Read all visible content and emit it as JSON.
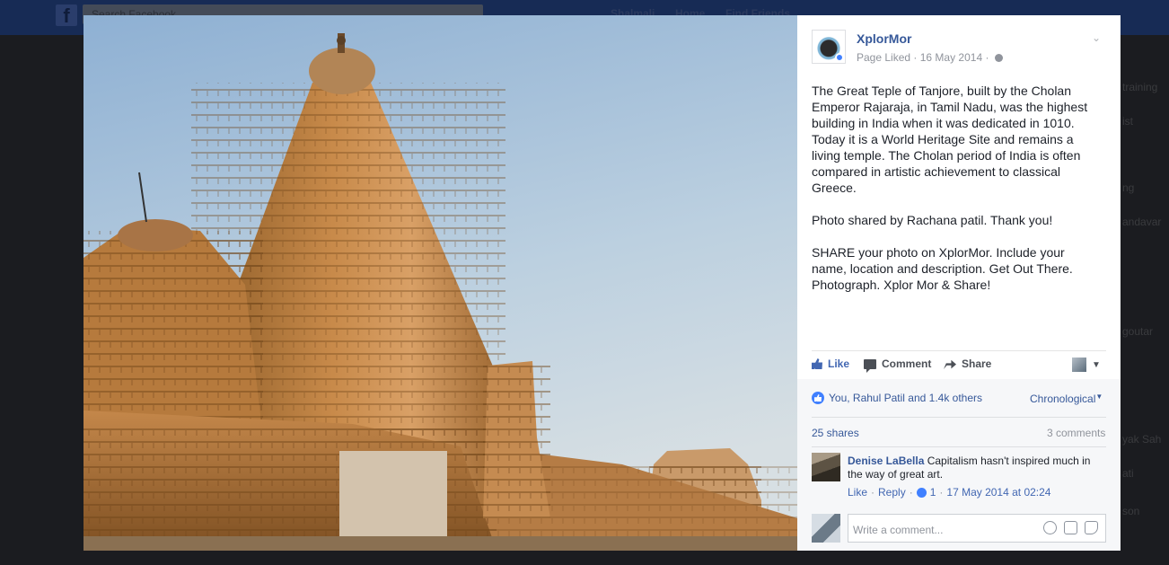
{
  "background_page": {
    "search_placeholder": "Search Facebook",
    "nav_items": [
      "Shalmali",
      "Home",
      "Find Friends"
    ],
    "sidebar_fragments": [
      "training",
      "ist",
      "ng",
      "andavar",
      "goutar",
      "yak Sah",
      "ati",
      "son"
    ]
  },
  "post": {
    "page_name": "XplorMor",
    "status": "Page Liked",
    "date": "16 May 2014",
    "text": "The Great Teple of Tanjore, built by the Cholan Emperor Rajaraja, in Tamil Nadu, was the highest building in India when it was dedicated in 1010. Today it is a World Heritage Site and remains a living temple. The Cholan period of India is often compared in artistic achievement to classical Greece.\n\nPhoto shared by Rachana patil. Thank you!\n\nSHARE your photo on XplorMor. Include your name, location and description. Get Out There. Photograph. Xplor Mor & Share!"
  },
  "actions": {
    "like": "Like",
    "comment": "Comment",
    "share": "Share"
  },
  "reactions": {
    "likers": "You, Rahul Patil and 1.4k others",
    "order": "Chronological",
    "shares": "25 shares",
    "comments": "3 comments"
  },
  "comment": {
    "author": "Denise LaBella",
    "text": "Capitalism hasn't inspired much in the way of great art.",
    "like_label": "Like",
    "reply_label": "Reply",
    "like_count": "1",
    "timestamp": "17 May 2014 at 02:24"
  },
  "composer": {
    "placeholder": "Write a comment..."
  },
  "colors": {
    "facebook_blue": "#4267b2",
    "link_blue": "#365899",
    "meta_grey": "#90949c",
    "theater_bg": "#1b1c20"
  },
  "icons": [
    "facebook-logo-icon",
    "search-icon",
    "globe-icon",
    "chevron-down-icon",
    "like-icon",
    "comment-icon",
    "share-icon",
    "audience-icon",
    "smile-icon",
    "camera-icon",
    "sticker-icon"
  ]
}
